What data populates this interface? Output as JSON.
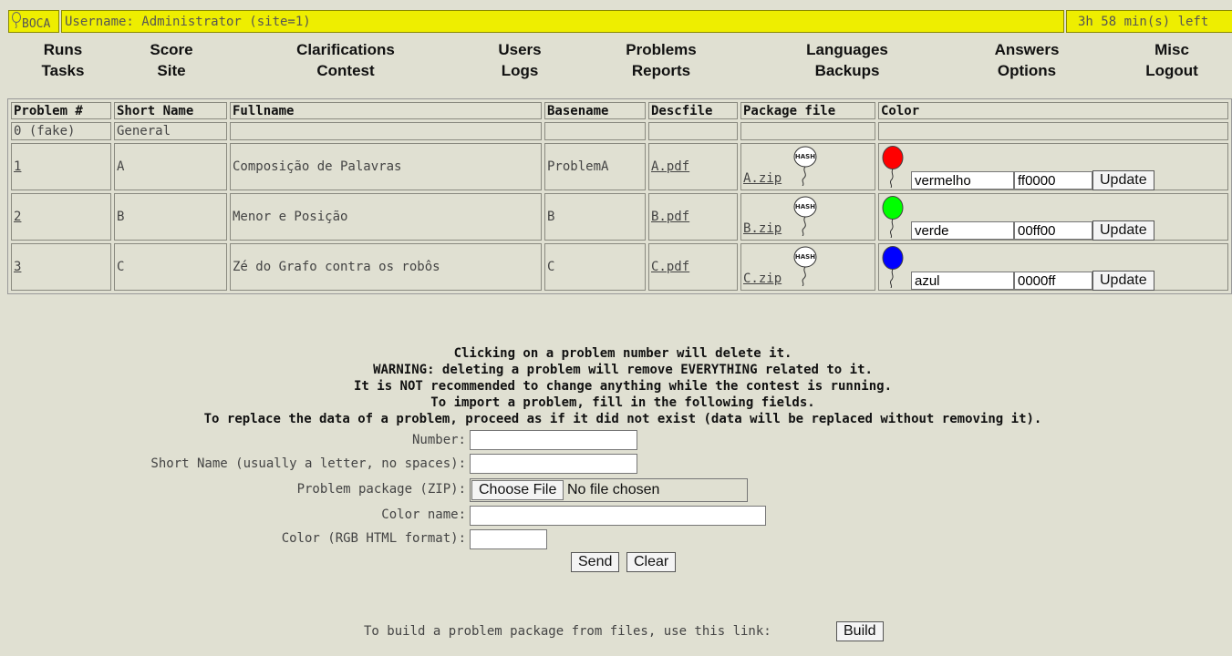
{
  "header": {
    "logo_text": "BOCA",
    "username_text": "Username: Administrator (site=1)",
    "time_left": "3h 58 min(s) left"
  },
  "menu": {
    "row1": [
      "Runs",
      "Score",
      "Clarifications",
      "Users",
      "Problems",
      "Languages",
      "Answers",
      "Misc"
    ],
    "row2": [
      "Tasks",
      "Site",
      "Contest",
      "Logs",
      "Reports",
      "Backups",
      "Options",
      "Logout"
    ]
  },
  "table": {
    "headers": [
      "Problem #",
      "Short Name",
      "Fullname",
      "Basename",
      "Descfile",
      "Package file",
      "Color"
    ],
    "fake_row": {
      "number": "0 (fake)",
      "short_name": "General"
    },
    "rows": [
      {
        "number": "1",
        "short_name": "A",
        "fullname": "Composição de Palavras",
        "basename": "ProblemA",
        "descfile": "A.pdf",
        "package": "A.zip",
        "color_name": "vermelho",
        "color_hex": "ff0000",
        "balloon_color": "#ff0000",
        "update_label": "Update"
      },
      {
        "number": "2",
        "short_name": "B",
        "fullname": "Menor e Posição",
        "basename": "B",
        "descfile": "B.pdf",
        "package": "B.zip",
        "color_name": "verde",
        "color_hex": "00ff00",
        "balloon_color": "#00ff00",
        "update_label": "Update"
      },
      {
        "number": "3",
        "short_name": "C",
        "fullname": "Zé do Grafo contra os robôs",
        "basename": "C",
        "descfile": "C.pdf",
        "package": "C.zip",
        "color_name": "azul",
        "color_hex": "0000ff",
        "balloon_color": "#0000ff",
        "update_label": "Update"
      }
    ],
    "hash_label": "HASH"
  },
  "messages": [
    "Clicking on a problem number will delete it.",
    "WARNING: deleting a problem will remove EVERYTHING related to it.",
    "It is NOT recommended to change anything while the contest is running.",
    "To import a problem, fill in the following fields.",
    "To replace the data of a problem, proceed as if it did not exist (data will be replaced without removing it)."
  ],
  "form": {
    "number_label": "Number:",
    "short_name_label": "Short Name (usually a letter, no spaces):",
    "package_label": "Problem package (ZIP):",
    "choose_file_label": "Choose File",
    "no_file_text": "No file chosen",
    "color_name_label": "Color name:",
    "color_rgb_label": "Color (RGB HTML format):",
    "send_label": "Send",
    "clear_label": "Clear"
  },
  "footer": {
    "build_text": "To build a problem package from files, use this link:",
    "build_label": "Build"
  },
  "colors": {
    "background": "#e0e0d2",
    "header_yellow": "#eeee00"
  }
}
